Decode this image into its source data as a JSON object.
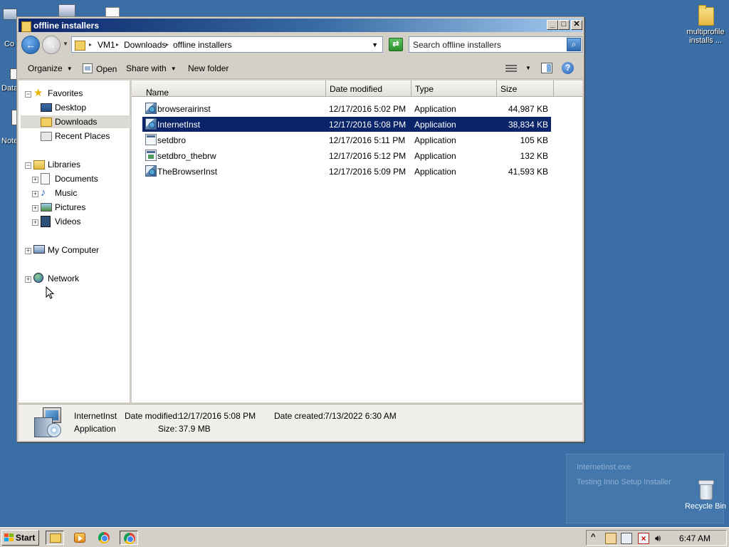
{
  "desktop": {
    "icons": [
      {
        "label": "Co",
        "name": "desktop-icon-computer"
      },
      {
        "label": "Data",
        "name": "desktop-icon-data"
      },
      {
        "label": "Note",
        "name": "desktop-icon-notepad"
      }
    ],
    "folder_icon_label": "multiprofile installs ...",
    "recycle_bin_label": "Recycle Bin",
    "toast": {
      "line1": "InternetInst.exe",
      "line2": "Testing Inno Setup Installer"
    }
  },
  "window": {
    "title": "offline installers",
    "min_symbol": "_",
    "max_symbol": "□",
    "close_symbol": "✕",
    "breadcrumb": [
      "VM1",
      "Downloads",
      "offline installers"
    ],
    "search_placeholder": "Search offline installers",
    "toolbar": {
      "organize": "Organize",
      "open": "Open",
      "share_with": "Share with",
      "new_folder": "New folder"
    },
    "nav": {
      "favorites": "Favorites",
      "desktop": "Desktop",
      "downloads": "Downloads",
      "recent_places": "Recent Places",
      "libraries": "Libraries",
      "documents": "Documents",
      "music": "Music",
      "pictures": "Pictures",
      "videos": "Videos",
      "my_computer": "My Computer",
      "network": "Network"
    },
    "columns": {
      "name": "Name",
      "date_modified": "Date modified",
      "type": "Type",
      "size": "Size"
    },
    "files": [
      {
        "name": "browserairinst",
        "date": "12/17/2016 5:02 PM",
        "type": "Application",
        "size": "44,987 KB",
        "icon": "installer-icon"
      },
      {
        "name": "InternetInst",
        "date": "12/17/2016 5:08 PM",
        "type": "Application",
        "size": "38,834 KB",
        "icon": "installer-icon"
      },
      {
        "name": "setdbro",
        "date": "12/17/2016 5:11 PM",
        "type": "Application",
        "size": "105 KB",
        "icon": "application-icon"
      },
      {
        "name": "setdbro_thebrw",
        "date": "12/17/2016 5:12 PM",
        "type": "Application",
        "size": "132 KB",
        "icon": "application-icon"
      },
      {
        "name": "TheBrowserInst",
        "date": "12/17/2016 5:09 PM",
        "type": "Application",
        "size": "41,593 KB",
        "icon": "installer-icon"
      }
    ],
    "details": {
      "filename": "InternetInst",
      "type": "Application",
      "date_modified_label": "Date modified:",
      "date_modified": "12/17/2016 5:08 PM",
      "size_label": "Size:",
      "size": "37.9 MB",
      "date_created_label": "Date created:",
      "date_created": "7/13/2022 6:30 AM"
    }
  },
  "taskbar": {
    "start_label": "Start",
    "clock": "6:47 AM"
  },
  "colors": {
    "desktop": "#3a6ea5",
    "selection": "#0a246a",
    "chrome": "#d4d0c8"
  }
}
